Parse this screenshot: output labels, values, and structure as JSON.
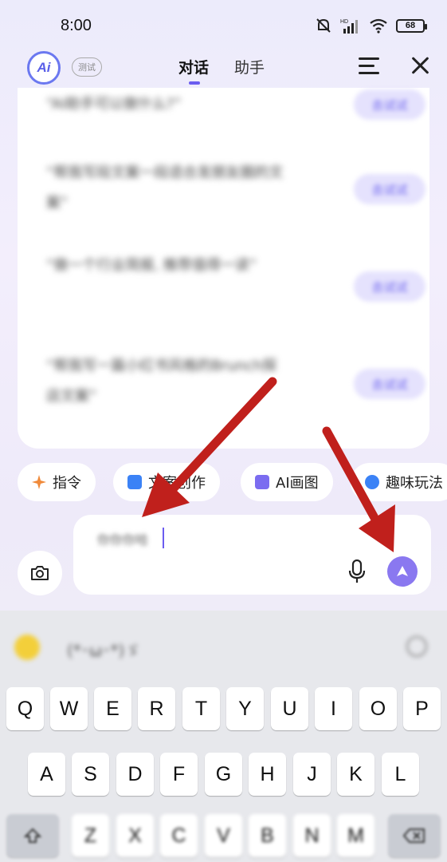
{
  "status_bar": {
    "time": "8:00",
    "network_label": "HD",
    "battery": "68"
  },
  "header": {
    "logo_text": "Ai",
    "badge": "测试",
    "tabs": [
      {
        "label": "对话",
        "active": true
      },
      {
        "label": "助手",
        "active": false
      }
    ]
  },
  "suggestions": [
    {
      "text": "“AI助手可以做什么?”",
      "button": "去试试"
    },
    {
      "text": "“帮我写段文案一段适合发朋友圈的文案”",
      "button": "去试试"
    },
    {
      "text": "“做一个行业简报, 推荐值得一读”",
      "button": "去试试"
    },
    {
      "text": "“帮我写一篇小红书风格的Brunch探店文案”",
      "button": "去试试"
    }
  ],
  "chips": [
    {
      "label": "指令",
      "icon": "sparkle-icon",
      "color": "#f08a3a"
    },
    {
      "label": "文案创作",
      "icon": "doc-icon",
      "color": "#3b82f6"
    },
    {
      "label": "AI画图",
      "icon": "image-icon",
      "color": "#7b6cf0"
    },
    {
      "label": "趣味玩法",
      "icon": "smile-icon",
      "color": "#3b82f6"
    }
  ],
  "input": {
    "value": "你你你哈"
  },
  "keyboard": {
    "kaomoji": "(*･ω･*)ゞ",
    "row1": [
      "Q",
      "W",
      "E",
      "R",
      "T",
      "Y",
      "U",
      "I",
      "O",
      "P"
    ],
    "row2": [
      "A",
      "S",
      "D",
      "F",
      "G",
      "H",
      "J",
      "K",
      "L"
    ],
    "row3": [
      "Z",
      "X",
      "C",
      "V",
      "B",
      "N",
      "M"
    ]
  },
  "colors": {
    "accent": "#6b5cf0",
    "arrow": "#c0201c"
  }
}
